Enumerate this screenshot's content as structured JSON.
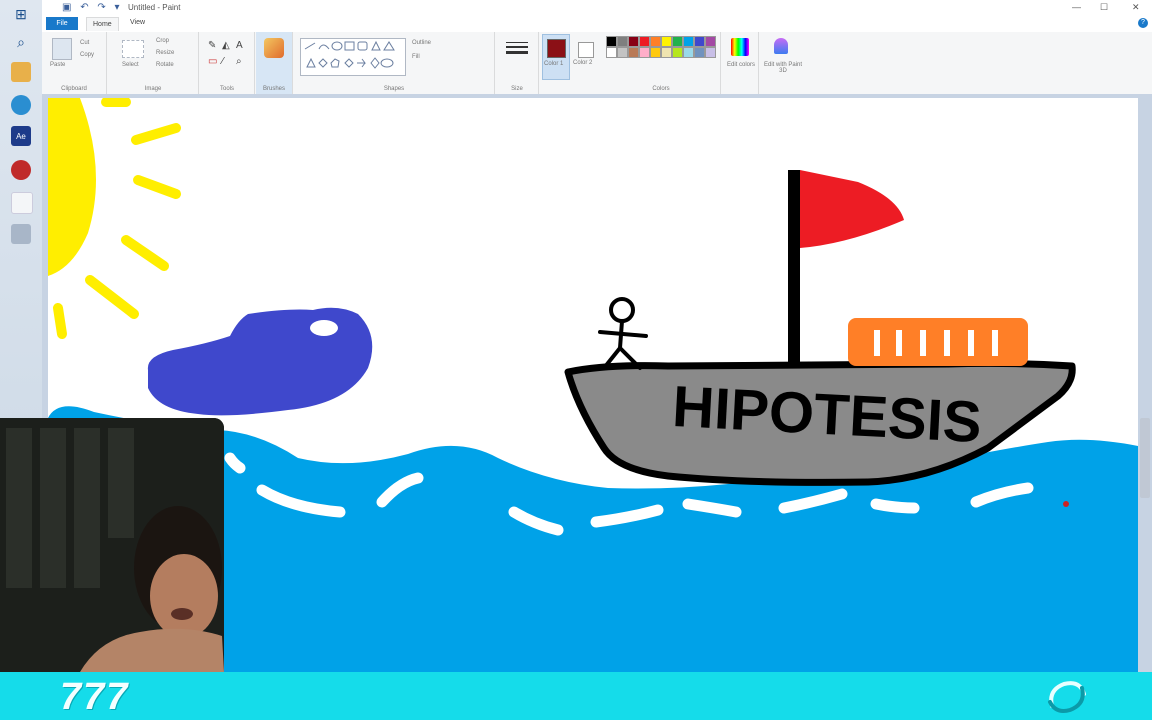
{
  "window": {
    "title": "Untitled - Paint"
  },
  "menu": {
    "file": "File",
    "home": "Home",
    "view": "View"
  },
  "ribbon": {
    "clipboard": {
      "paste": "Paste",
      "cut": "Cut",
      "copy": "Copy",
      "label": "Clipboard"
    },
    "image": {
      "select": "Select",
      "crop": "Crop",
      "resize": "Resize",
      "rotate": "Rotate",
      "label": "Image"
    },
    "tools": {
      "label": "Tools"
    },
    "brushes": {
      "label": "Brushes"
    },
    "shapes": {
      "outline": "Outline",
      "fill": "Fill",
      "label": "Shapes"
    },
    "size": {
      "label": "Size"
    },
    "color1": {
      "label": "Color 1",
      "value": "#8b1016"
    },
    "color2": {
      "label": "Color 2",
      "value": "#ffffff"
    },
    "colors": {
      "label": "Colors"
    },
    "edit_colors": "Edit colors",
    "paint3d": "Edit with Paint 3D",
    "palette": [
      "#000000",
      "#7f7f7f",
      "#880015",
      "#ed1c24",
      "#ff7f27",
      "#fff200",
      "#22b14c",
      "#00a2e8",
      "#3f48cc",
      "#a349a4",
      "#ffffff",
      "#c3c3c3",
      "#b97a57",
      "#ffaec9",
      "#ffc90e",
      "#efe4b0",
      "#b5e61d",
      "#99d9ea",
      "#7092be",
      "#c8bfe7"
    ]
  },
  "drawing": {
    "boat_text": "HIPOTESIS"
  },
  "stream": {
    "counter": "777"
  }
}
